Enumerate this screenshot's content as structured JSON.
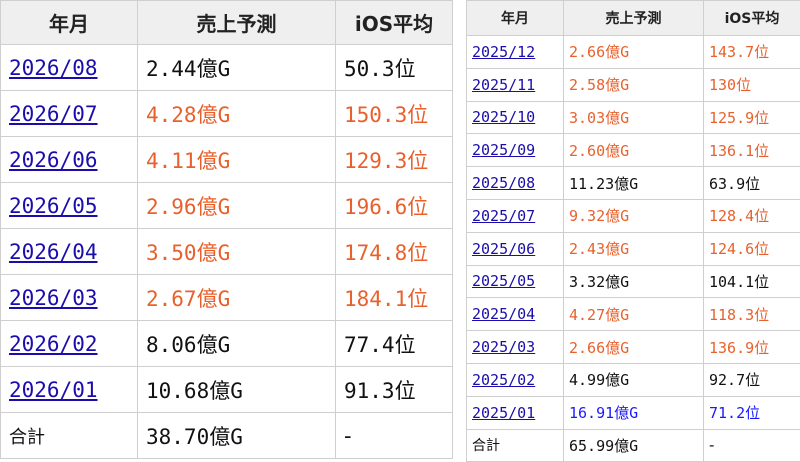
{
  "colors": {
    "link": "#1a0dab",
    "orange": "#e8612c",
    "black": "#111111",
    "blue": "#1a1aff"
  },
  "headers": [
    "年月",
    "売上予測",
    "iOS平均"
  ],
  "left_table": {
    "rows": [
      {
        "month": "2026/08",
        "sales": "2.44億G",
        "ios": "50.3位",
        "color": "black"
      },
      {
        "month": "2026/07",
        "sales": "4.28億G",
        "ios": "150.3位",
        "color": "orange"
      },
      {
        "month": "2026/06",
        "sales": "4.11億G",
        "ios": "129.3位",
        "color": "orange"
      },
      {
        "month": "2026/05",
        "sales": "2.96億G",
        "ios": "196.6位",
        "color": "orange"
      },
      {
        "month": "2026/04",
        "sales": "3.50億G",
        "ios": "174.8位",
        "color": "orange"
      },
      {
        "month": "2026/03",
        "sales": "2.67億G",
        "ios": "184.1位",
        "color": "orange"
      },
      {
        "month": "2026/02",
        "sales": "8.06億G",
        "ios": "77.4位",
        "color": "black"
      },
      {
        "month": "2026/01",
        "sales": "10.68億G",
        "ios": "91.3位",
        "color": "black"
      }
    ],
    "total": {
      "label": "合計",
      "sales": "38.70億G",
      "ios": "-"
    }
  },
  "right_table": {
    "rows": [
      {
        "month": "2025/12",
        "sales": "2.66億G",
        "ios": "143.7位",
        "color": "orange"
      },
      {
        "month": "2025/11",
        "sales": "2.58億G",
        "ios": "130位",
        "color": "orange"
      },
      {
        "month": "2025/10",
        "sales": "3.03億G",
        "ios": "125.9位",
        "color": "orange"
      },
      {
        "month": "2025/09",
        "sales": "2.60億G",
        "ios": "136.1位",
        "color": "orange"
      },
      {
        "month": "2025/08",
        "sales": "11.23億G",
        "ios": "63.9位",
        "color": "black"
      },
      {
        "month": "2025/07",
        "sales": "9.32億G",
        "ios": "128.4位",
        "color": "orange"
      },
      {
        "month": "2025/06",
        "sales": "2.43億G",
        "ios": "124.6位",
        "color": "orange"
      },
      {
        "month": "2025/05",
        "sales": "3.32億G",
        "ios": "104.1位",
        "color": "black"
      },
      {
        "month": "2025/04",
        "sales": "4.27億G",
        "ios": "118.3位",
        "color": "orange"
      },
      {
        "month": "2025/03",
        "sales": "2.66億G",
        "ios": "136.9位",
        "color": "orange"
      },
      {
        "month": "2025/02",
        "sales": "4.99億G",
        "ios": "92.7位",
        "color": "black"
      },
      {
        "month": "2025/01",
        "sales": "16.91億G",
        "ios": "71.2位",
        "color": "blue"
      }
    ],
    "total": {
      "label": "合計",
      "sales": "65.99億G",
      "ios": "-"
    }
  }
}
